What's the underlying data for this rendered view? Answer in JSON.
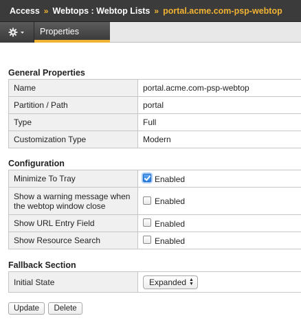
{
  "breadcrumb": {
    "items": [
      "Access",
      "Webtops : Webtop Lists"
    ],
    "current": "portal.acme.com-psp-webtop",
    "separator": "»"
  },
  "toolbar": {
    "gear_icon": "gear-icon",
    "dropdown_icon": "chevron-down-icon",
    "tabs": [
      {
        "label": "Properties",
        "active": true
      }
    ]
  },
  "general": {
    "title": "General Properties",
    "rows": [
      {
        "label": "Name",
        "value": "portal.acme.com-psp-webtop"
      },
      {
        "label": "Partition / Path",
        "value": "portal"
      },
      {
        "label": "Type",
        "value": "Full"
      },
      {
        "label": "Customization Type",
        "value": "Modern"
      }
    ]
  },
  "configuration": {
    "title": "Configuration",
    "rows": [
      {
        "label": "Minimize To Tray",
        "checkbox_label": "Enabled",
        "checked": true
      },
      {
        "label": "Show a warning message when the webtop window close",
        "checkbox_label": "Enabled",
        "checked": false
      },
      {
        "label": "Show URL Entry Field",
        "checkbox_label": "Enabled",
        "checked": false
      },
      {
        "label": "Show Resource Search",
        "checkbox_label": "Enabled",
        "checked": false
      }
    ]
  },
  "fallback": {
    "title": "Fallback Section",
    "rows": [
      {
        "label": "Initial State",
        "selected": "Expanded"
      }
    ]
  },
  "actions": {
    "update_label": "Update",
    "delete_label": "Delete"
  },
  "colors": {
    "header_bg": "#3b3b3b",
    "accent": "#f0b232",
    "label_cell_bg": "#f0f0f0",
    "checkbox_checked": "#2a7fe0"
  }
}
